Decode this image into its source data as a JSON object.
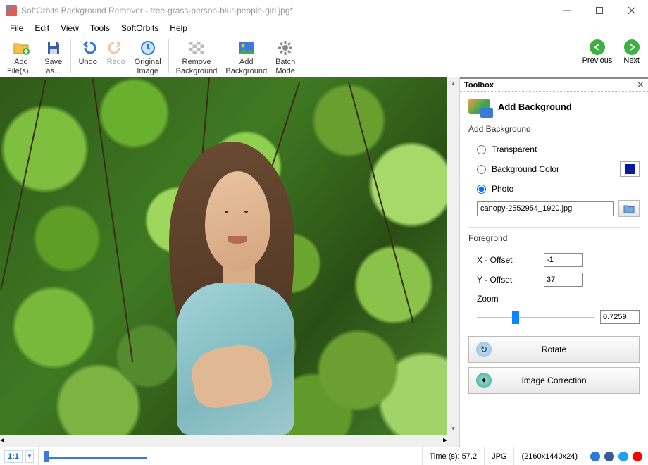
{
  "window": {
    "title": "SoftOrbits Background Remover - tree-grass-person-blur-people-girl.jpg*"
  },
  "menu": {
    "file": "File",
    "edit": "Edit",
    "view": "View",
    "tools": "Tools",
    "softorbits": "SoftOrbits",
    "help": "Help"
  },
  "toolbar": {
    "add_files": "Add\nFile(s)...",
    "save_as": "Save\nas...",
    "undo": "Undo",
    "redo": "Redo",
    "original_image": "Original\nImage",
    "remove_bg": "Remove\nBackground",
    "add_bg": "Add\nBackground",
    "batch": "Batch\nMode",
    "previous": "Previous",
    "next": "Next"
  },
  "toolbox": {
    "title": "Toolbox",
    "panel_title": "Add Background",
    "section_add_bg": "Add Background",
    "opt_transparent": "Transparent",
    "opt_bg_color": "Background Color",
    "opt_photo": "Photo",
    "bg_color_hex": "#0a1a9a",
    "photo_filename": "canopy-2552954_1920.jpg",
    "section_fg": "Foregrond",
    "x_offset_label": "X - Offset",
    "x_offset_value": "-1",
    "y_offset_label": "Y - Offset",
    "y_offset_value": "37",
    "zoom_label": "Zoom",
    "zoom_value": "0.7259",
    "zoom_slider_pct": 30,
    "rotate_btn": "Rotate",
    "image_correction_btn": "Image Correction"
  },
  "status": {
    "zoom_ratio": "1:1",
    "time_label": "Time (s): 57.2",
    "format": "JPG",
    "dimensions": "(2160x1440x24)"
  }
}
